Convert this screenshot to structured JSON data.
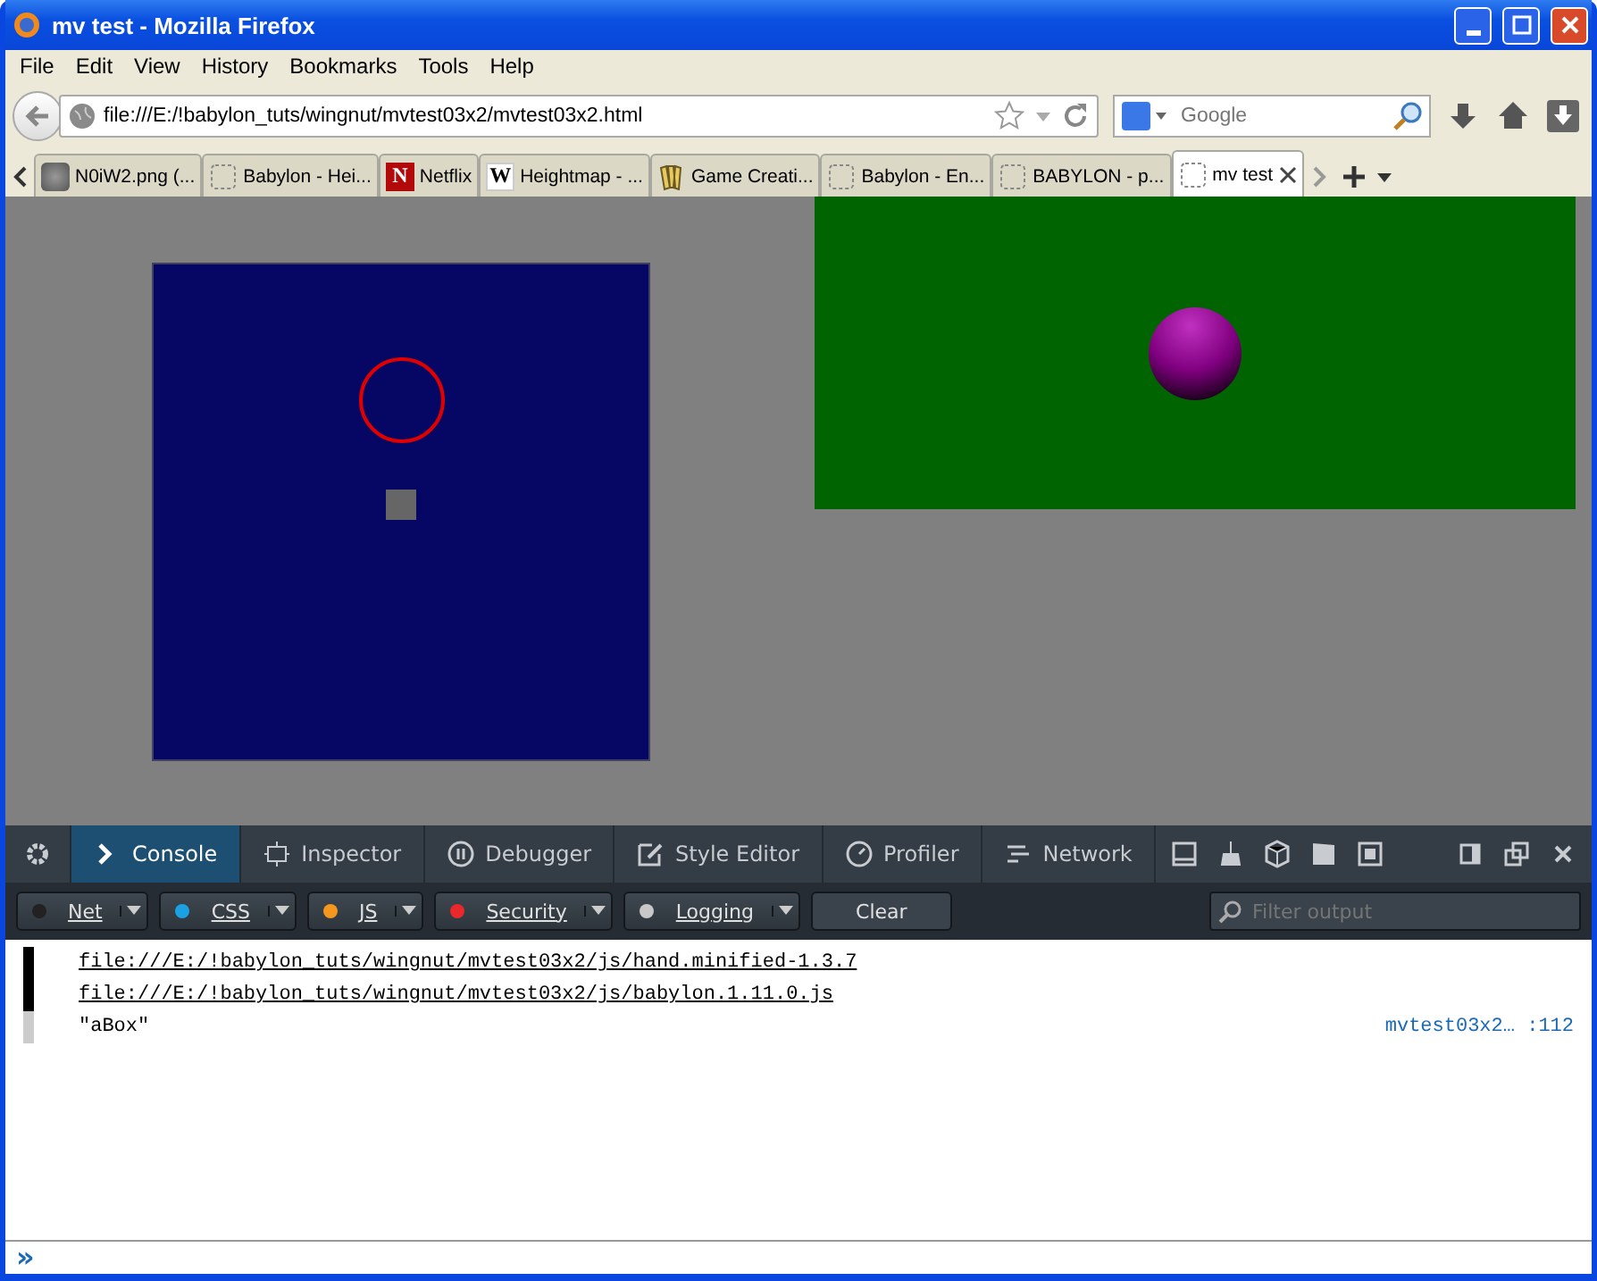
{
  "window": {
    "title": "mv test - Mozilla Firefox"
  },
  "menu": [
    "File",
    "Edit",
    "View",
    "History",
    "Bookmarks",
    "Tools",
    "Help"
  ],
  "address_bar": {
    "value": "file:///E:/!babylon_tuts/wingnut/mvtest03x2/mvtest03x2.html"
  },
  "search": {
    "placeholder": "Google"
  },
  "tabs": [
    {
      "label": "N0iW2.png (...",
      "kind": "image",
      "selected": false
    },
    {
      "label": "Babylon - Hei...",
      "kind": "page",
      "selected": false
    },
    {
      "label": "Netflix",
      "kind": "letter",
      "glyph": "N",
      "selected": false
    },
    {
      "label": "Heightmap - ...",
      "kind": "letter",
      "glyph": "W",
      "selected": false
    },
    {
      "label": "Game Creati...",
      "kind": "books",
      "selected": false
    },
    {
      "label": "Babylon - En...",
      "kind": "page",
      "selected": false
    },
    {
      "label": "BABYLON - p...",
      "kind": "page",
      "selected": false
    },
    {
      "label": "mv test",
      "kind": "page",
      "selected": true
    }
  ],
  "devtools": {
    "tabs": [
      {
        "label": "Console",
        "selected": true
      },
      {
        "label": "Inspector",
        "selected": false
      },
      {
        "label": "Debugger",
        "selected": false
      },
      {
        "label": "Style Editor",
        "selected": false
      },
      {
        "label": "Profiler",
        "selected": false
      },
      {
        "label": "Network",
        "selected": false
      }
    ],
    "filters": [
      {
        "label": "Net",
        "color": "#222222"
      },
      {
        "label": "CSS",
        "color": "#1ba1e2"
      },
      {
        "label": "JS",
        "color": "#f5961e"
      },
      {
        "label": "Security",
        "color": "#e8282b"
      },
      {
        "label": "Logging",
        "color": "#c8c8c8"
      }
    ],
    "clear_button": "Clear",
    "filter_field": {
      "placeholder": "Filter output"
    }
  },
  "console": [
    {
      "kind": "link",
      "text": "file:///E:/!babylon_tuts/wingnut/mvtest03x2/js/hand.minified-1.3.7"
    },
    {
      "kind": "link",
      "text": "file:///E:/!babylon_tuts/wingnut/mvtest03x2/js/babylon.1.11.0.js"
    },
    {
      "kind": "log",
      "text": "\"aBox\"",
      "source": "mvtest03x2… :112"
    }
  ],
  "console_input": {
    "prompt": "»"
  }
}
